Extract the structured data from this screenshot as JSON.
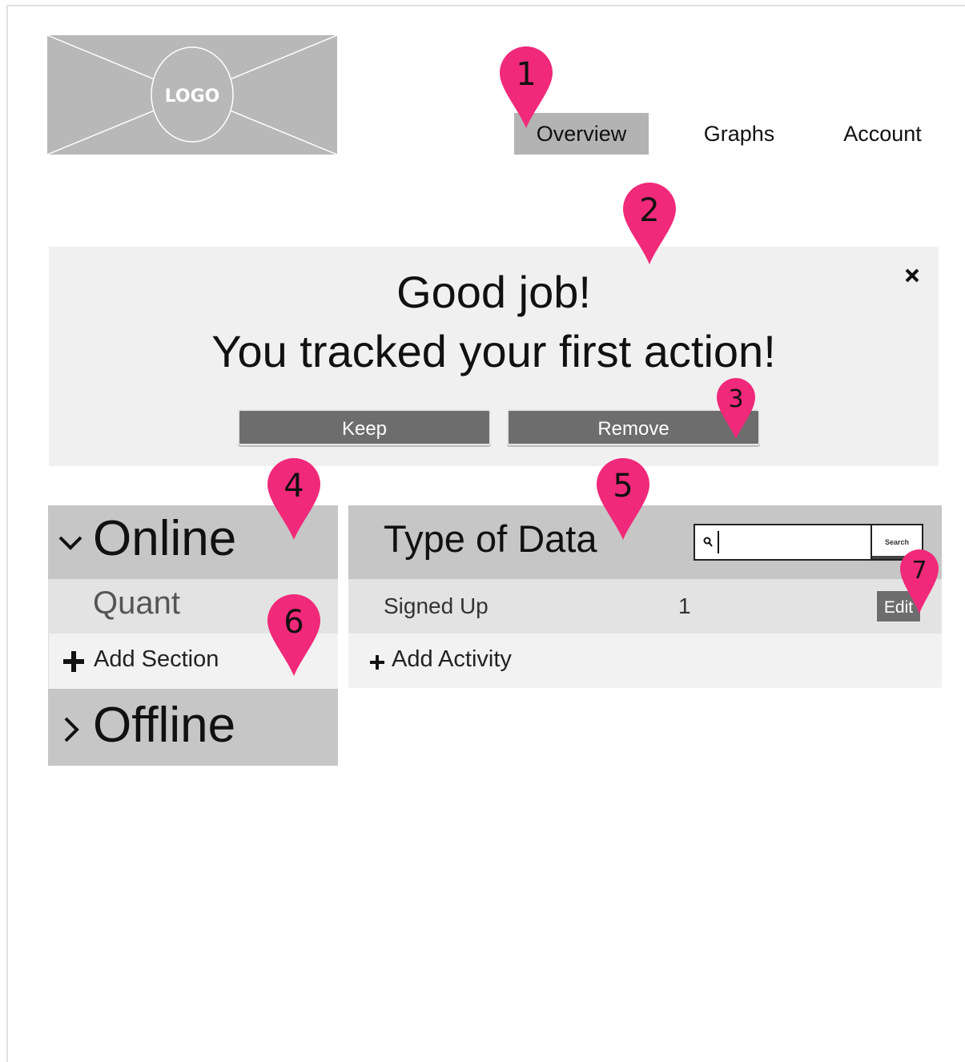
{
  "header": {
    "logo_text": "LOGO",
    "nav": [
      {
        "label": "Overview",
        "active": true
      },
      {
        "label": "Graphs",
        "active": false
      },
      {
        "label": "Account",
        "active": false
      }
    ]
  },
  "alert": {
    "line1": "Good job!",
    "line2": "You tracked your first action!",
    "keep_label": "Keep",
    "remove_label": "Remove"
  },
  "sidebar": {
    "online_label": "Online",
    "quant_label": "Quant",
    "add_section_label": "Add Section",
    "offline_label": "Offline"
  },
  "panel": {
    "title": "Type of Data",
    "search_label": "Search",
    "rows": [
      {
        "label": "Signed Up",
        "value": "1",
        "edit_label": "Edit"
      }
    ],
    "add_activity_label": "Add Activity"
  },
  "markers": [
    "1",
    "2",
    "3",
    "4",
    "5",
    "6",
    "7"
  ],
  "colors": {
    "marker": "#f0297a",
    "button": "#6d6d6d",
    "panel_head": "#c6c6c6",
    "nav_active": "#b3b3b3"
  }
}
